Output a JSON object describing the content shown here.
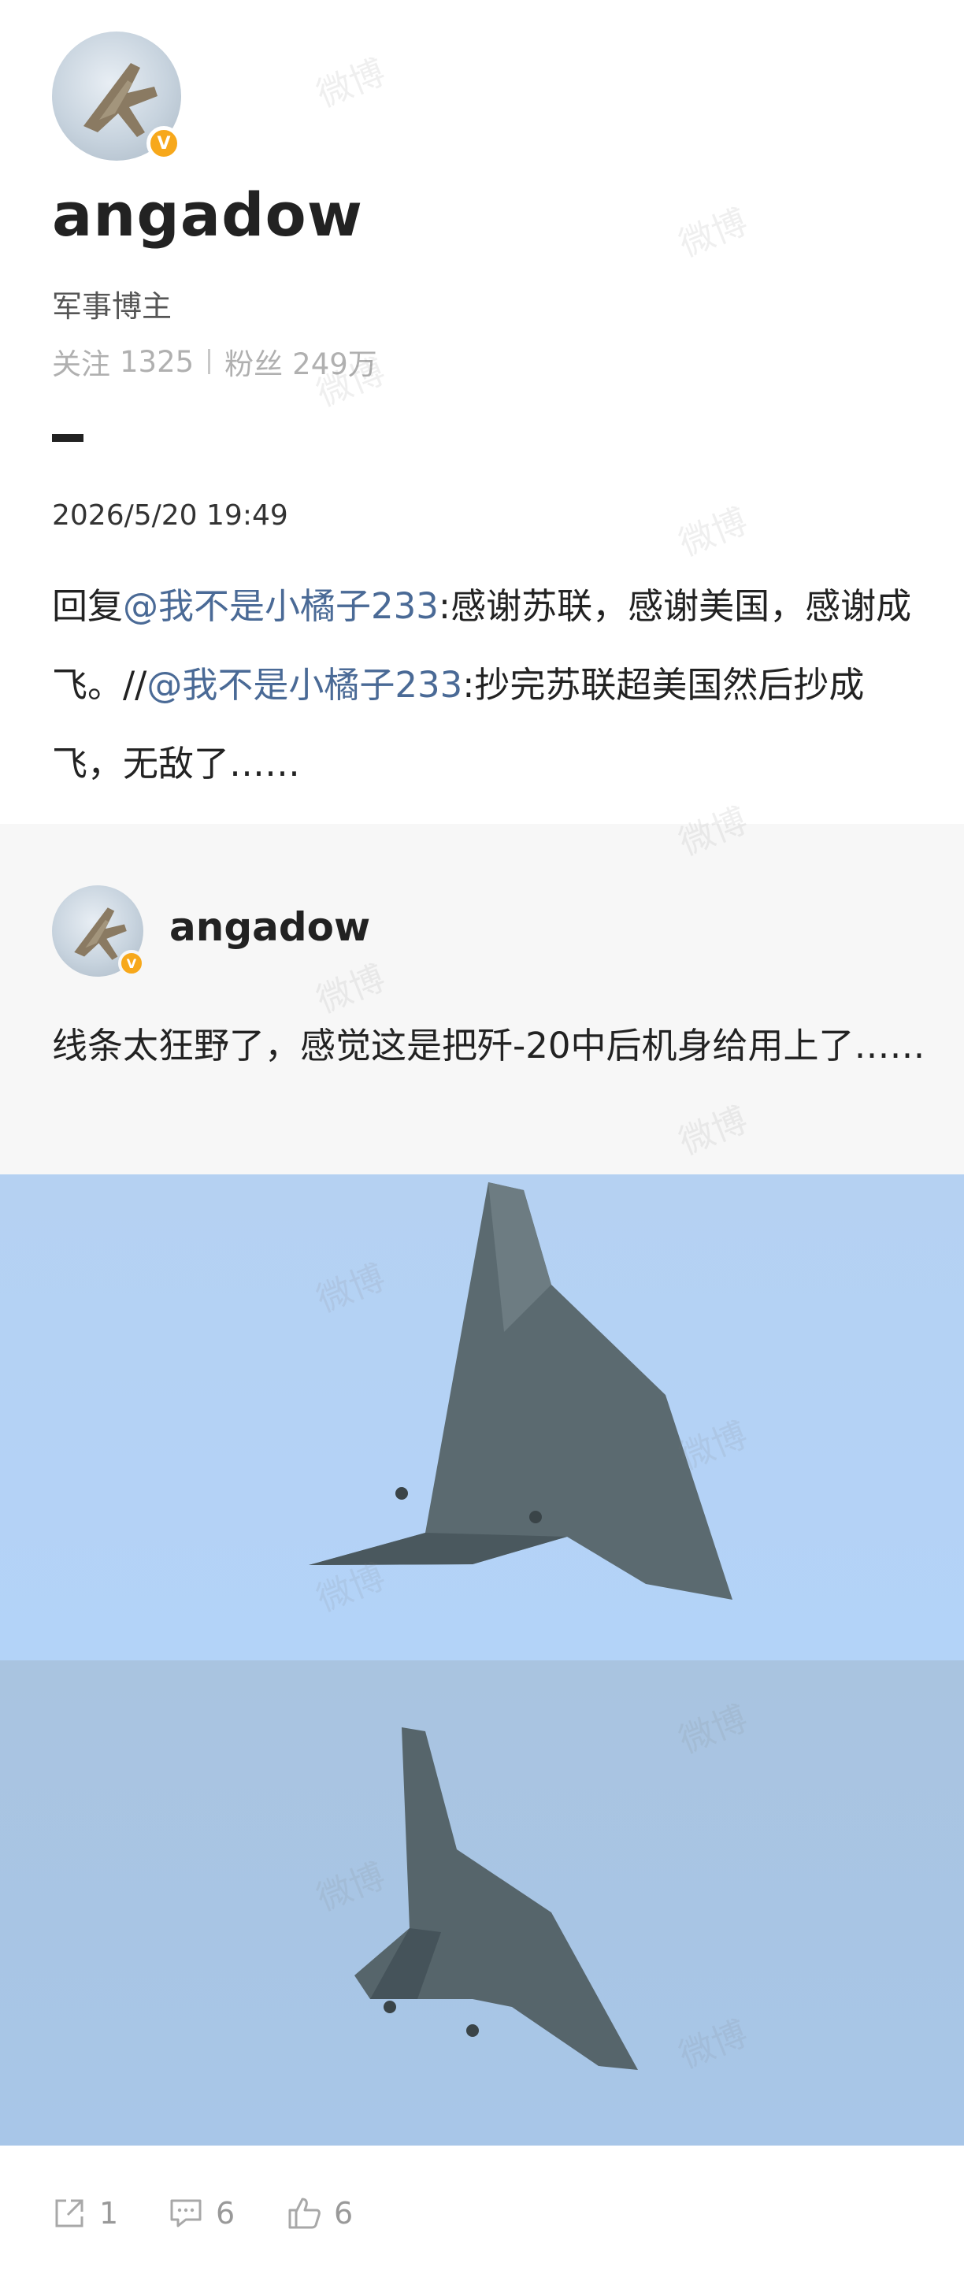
{
  "profile": {
    "username": "angadow",
    "bio": "军事博主",
    "follow_label": "关注",
    "follow_count": "1325",
    "fans_label": "粉丝",
    "fans_count": "249万",
    "verified_badge": "V"
  },
  "post": {
    "date": "2026/5/20 19:49",
    "reply_prefix": "回复",
    "mention_1": "@我不是小橘子233",
    "text_1": ":感谢苏联，感谢美国，感谢成飞。//",
    "mention_2": "@我不是小橘子233",
    "text_2": ":抄完苏联超美国然后抄成飞，无敌了……"
  },
  "repost": {
    "username": "angadow",
    "verified_badge": "V",
    "text": "线条太狂野了，感觉这是把歼-20中后机身给用上了……"
  },
  "watermark": "微博",
  "actions": {
    "share_count": "1",
    "comment_count": "6",
    "like_count": "6",
    "share_icon": "share-icon",
    "comment_icon": "comment-icon",
    "like_icon": "thumbs-up-icon"
  },
  "colors": {
    "mention": "#4a6a96",
    "badge": "#f7a81b",
    "sky_top": "#b3d3f8",
    "sky_bottom": "#a8c6e8",
    "aircraft": "#5a6a72"
  }
}
